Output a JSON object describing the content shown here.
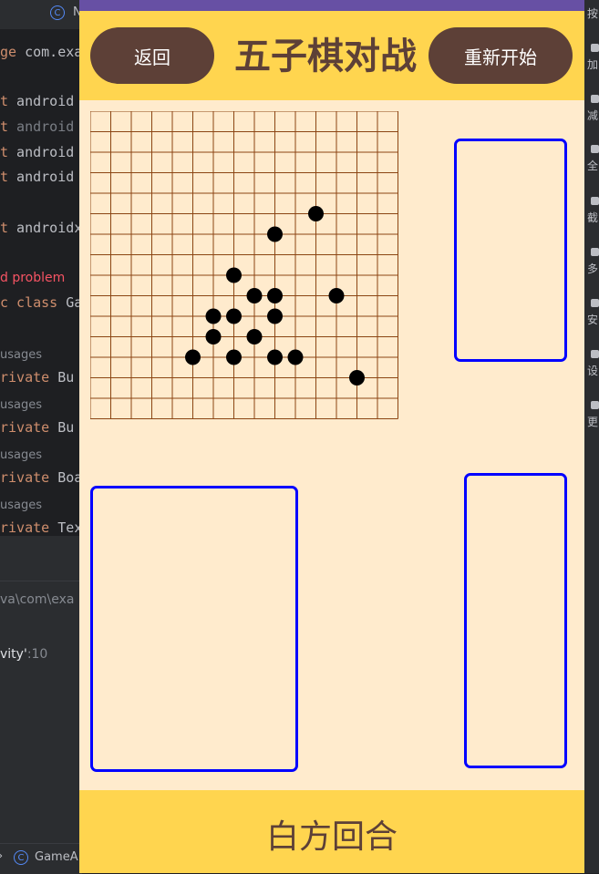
{
  "ide": {
    "tabs": [
      {
        "icon": "class-icon",
        "label": "N"
      },
      {
        "icon": "class-icon",
        "label": "GameA"
      }
    ],
    "code_lines": [
      {
        "kw": "ge",
        "text": " com.exa"
      },
      {
        "kw": "t",
        "text": " android"
      },
      {
        "kw": "t",
        "text": " android"
      },
      {
        "kw": "t",
        "text": " android"
      },
      {
        "kw": "t",
        "text": " android"
      },
      {
        "kw": "t",
        "text": " androidx"
      },
      {
        "kw": "",
        "text": "d problem"
      },
      {
        "kw": "c class",
        "text": " Ga"
      },
      {
        "kw": "",
        "text": "usages"
      },
      {
        "kw": "rivate",
        "text": " Bu"
      },
      {
        "kw": "",
        "text": "usages"
      },
      {
        "kw": "rivate",
        "text": " Bu"
      },
      {
        "kw": "",
        "text": "usages"
      },
      {
        "kw": "rivate",
        "text": " Boa"
      },
      {
        "kw": "",
        "text": "usages"
      },
      {
        "kw": "rivate",
        "text": " Tex"
      }
    ],
    "lower_path": "va\\com\\exa",
    "lower_ref": "vity'",
    "lower_ref_line": ":10",
    "right_labels": [
      "按",
      "加",
      "减",
      "全",
      "截",
      "多",
      "安",
      "设",
      "更"
    ]
  },
  "app": {
    "back_label": "返回",
    "title": "五子棋对战",
    "restart_label": "重新开始",
    "turn_text": "白方回合"
  },
  "board": {
    "size": 15,
    "cell": 22.5,
    "stones": [
      {
        "col": 11,
        "row": 5
      },
      {
        "col": 9,
        "row": 6
      },
      {
        "col": 7,
        "row": 8
      },
      {
        "col": 8,
        "row": 9
      },
      {
        "col": 9,
        "row": 9
      },
      {
        "col": 12,
        "row": 9
      },
      {
        "col": 6,
        "row": 10
      },
      {
        "col": 7,
        "row": 10
      },
      {
        "col": 9,
        "row": 10
      },
      {
        "col": 6,
        "row": 11
      },
      {
        "col": 8,
        "row": 11
      },
      {
        "col": 5,
        "row": 12
      },
      {
        "col": 7,
        "row": 12
      },
      {
        "col": 9,
        "row": 12
      },
      {
        "col": 10,
        "row": 12
      },
      {
        "col": 13,
        "row": 13
      }
    ]
  },
  "colors": {
    "header": "#ffd54f",
    "button": "#5d4037",
    "board_bg": "#ffebcd",
    "grid": "#8b4513",
    "stone": "#000000",
    "box_border": "#0000ff",
    "status_bar": "#6750a4"
  }
}
